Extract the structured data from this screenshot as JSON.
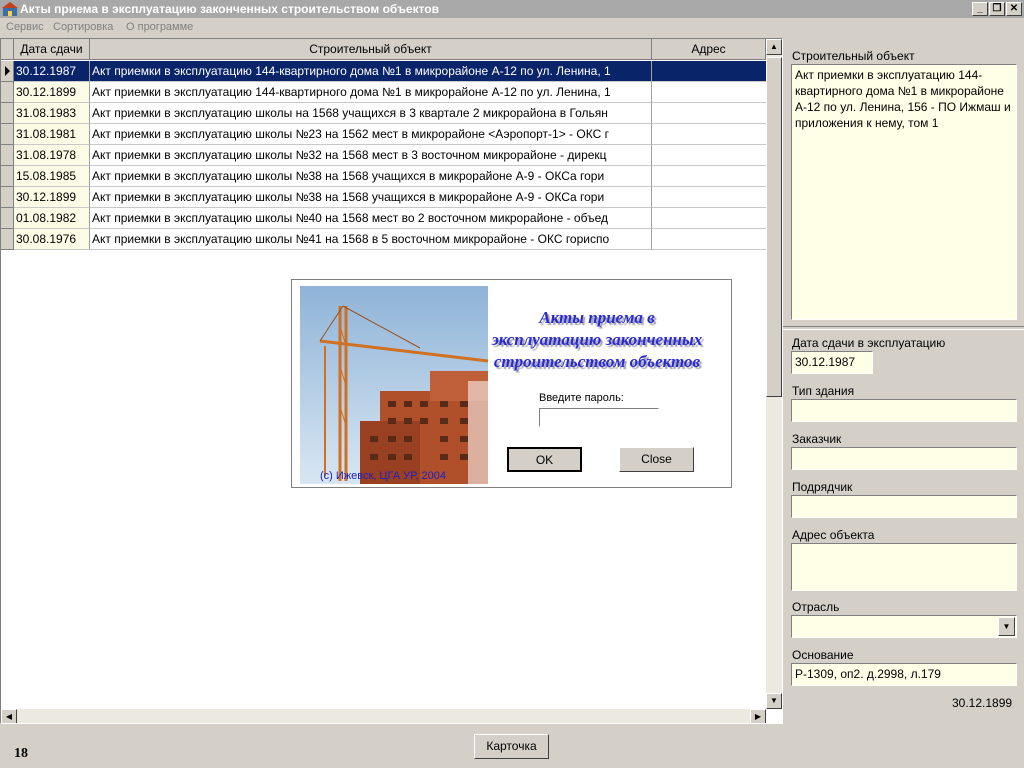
{
  "window": {
    "title": "Акты приема в эксплуатацию законченных строительством объектов",
    "minimize": "_",
    "restore": "❐",
    "close": "✕"
  },
  "menu": {
    "items": [
      "Сервис",
      "Сортировка",
      "О программе"
    ]
  },
  "grid": {
    "columns": [
      "Дата сдачи",
      "Строительный объект",
      "Адрес"
    ],
    "rows": [
      {
        "date": "30.12.1987",
        "object": "Акт приемки в эксплуатацию 144-квартирного дома №1 в микрорайоне А-12 по ул. Ленина, 1",
        "address": ""
      },
      {
        "date": "30.12.1899",
        "object": "Акт приемки в эксплуатацию 144-квартирного дома №1 в микрорайоне А-12 по ул. Ленина, 1",
        "address": ""
      },
      {
        "date": "31.08.1983",
        "object": "Акт приемки в эксплуатацию школы на 1568 учащихся в 3 квартале 2 микрорайона в Гольян",
        "address": ""
      },
      {
        "date": "31.08.1981",
        "object": "Акт приемки в эксплуатацию школы №23 на 1562 мест в микрорайоне <Аэропорт-1> - ОКС г",
        "address": ""
      },
      {
        "date": "31.08.1978",
        "object": "Акт приемки в эксплуатацию школы №32 на 1568 мест в 3 восточном микрорайоне - дирекц",
        "address": ""
      },
      {
        "date": "15.08.1985",
        "object": "Акт приемки в эксплуатацию школы №38 на 1568 учащихся в микрорайоне А-9 - ОКСа гори",
        "address": ""
      },
      {
        "date": "30.12.1899",
        "object": "Акт приемки в эксплуатацию школы №38 на 1568 учащихся в микрорайоне А-9 - ОКСа гори",
        "address": ""
      },
      {
        "date": "01.08.1982",
        "object": "Акт приемки в эксплуатацию школы №40 на 1568 мест во 2 восточном микрорайоне - объед",
        "address": ""
      },
      {
        "date": "30.08.1976",
        "object": "Акт приемки в эксплуатацию школы №41 на 1568 в 5 восточном микрорайоне - ОКС гориспо",
        "address": ""
      }
    ],
    "selected_row": 0
  },
  "detail": {
    "object_label": "Строительный объект",
    "object_value": "Акт приемки в эксплуатацию 144-квартирного дома №1 в микрорайоне А-12 по ул. Ленина, 156 - ПО Ижмаш и приложения к нему, том 1",
    "date_label": "Дата сдачи в эксплуатацию",
    "date_value": "30.12.1987",
    "building_type_label": "Тип здания",
    "building_type_value": "",
    "customer_label": "Заказчик",
    "customer_value": "",
    "contractor_label": "Подрядчик",
    "contractor_value": "",
    "address_label": "Адрес объекта",
    "address_value": "",
    "industry_label": "Отрасль",
    "industry_value": "",
    "basis_label": "Основание",
    "basis_value": "Р-1309, оп2. д.2998, л.179",
    "footer_date": "30.12.1899"
  },
  "dialog": {
    "title_line1": "Акты приема в",
    "title_line2": "эксплуатацию законченных",
    "title_line3": "строительством объектов",
    "password_label": "Введите пароль:",
    "password_value": "",
    "ok_label": "OK",
    "close_label": "Close",
    "copyright": "(c) Ижевск, ЦГА УР, 2004"
  },
  "bottom": {
    "record_count": "18",
    "card_button": "Карточка"
  },
  "colors": {
    "selection": "#0a246a",
    "field_background": "#ffffe7",
    "dialog_title": "#2a2ad0",
    "window_face": "#d4d0c8"
  }
}
